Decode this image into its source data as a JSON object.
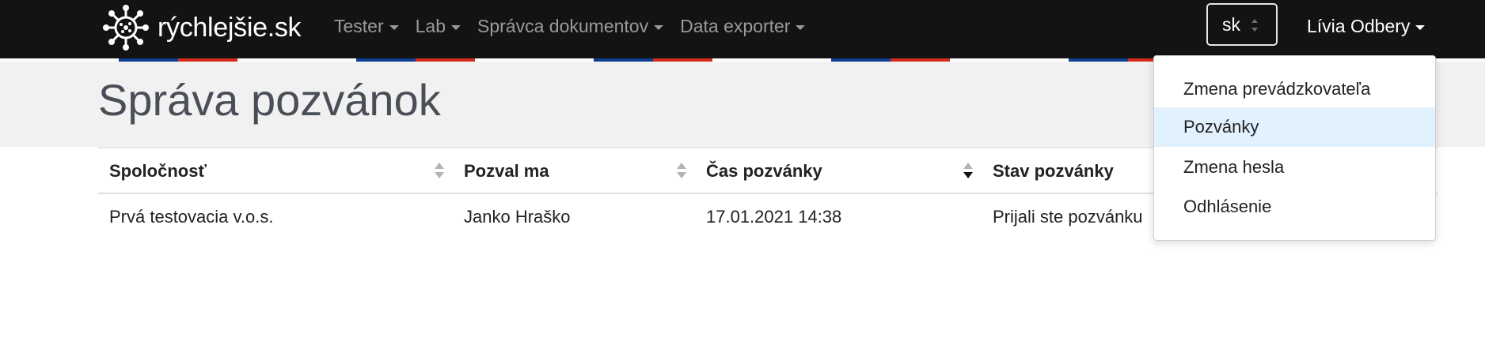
{
  "brand": {
    "name": "rýchlejšie.sk",
    "logo_icon": "virus-logo-icon"
  },
  "nav": {
    "items": [
      {
        "label": "Tester"
      },
      {
        "label": "Lab"
      },
      {
        "label": "Správca dokumentov"
      },
      {
        "label": "Data exporter"
      }
    ]
  },
  "language": {
    "value": "sk"
  },
  "user": {
    "name": "Lívia Odbery"
  },
  "user_dropdown": {
    "items": [
      {
        "label": "Zmena prevádzkovateľa",
        "active": false
      },
      {
        "label": "Pozvánky",
        "active": true
      },
      {
        "label": "Zmena hesla",
        "active": false
      },
      {
        "label": "Odhlásenie",
        "active": false
      }
    ]
  },
  "page": {
    "title": "Správa pozvánok"
  },
  "table": {
    "columns": [
      {
        "label": "Spoločnosť",
        "sort": "none"
      },
      {
        "label": "Pozval ma",
        "sort": "none"
      },
      {
        "label": "Čas pozvánky",
        "sort": "desc"
      },
      {
        "label": "Stav pozvánky",
        "sort": "none"
      }
    ],
    "rows": [
      [
        "Prvá testovacia v.o.s.",
        "Janko Hraško",
        "17.01.2021 14:38",
        "Prijali ste pozvánku"
      ]
    ]
  },
  "colors": {
    "navbar": "#131313",
    "header_band": "#f1f1f1",
    "stripe_blue": "#0b3d91",
    "stripe_red": "#d52b1e",
    "active_item": "#e1f1fd"
  }
}
